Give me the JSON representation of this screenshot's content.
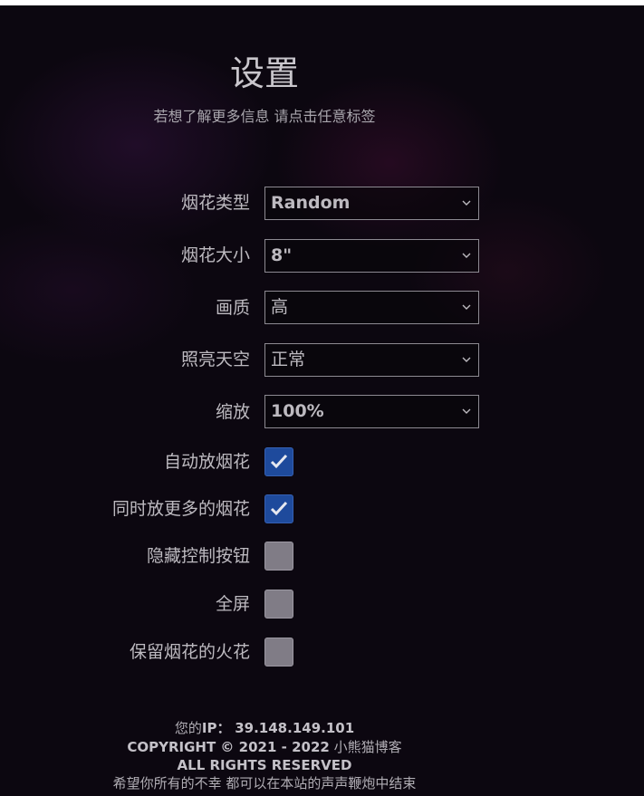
{
  "header": {
    "title": "设置",
    "subtitle": "若想了解更多信息 请点击任意标签"
  },
  "settings": {
    "firework_type": {
      "label": "烟花类型",
      "value": "Random"
    },
    "firework_size": {
      "label": "烟花大小",
      "value": "8\""
    },
    "quality": {
      "label": "画质",
      "value": "高"
    },
    "sky_lighting": {
      "label": "照亮天空",
      "value": "正常"
    },
    "zoom": {
      "label": "缩放",
      "value": "100%"
    },
    "auto_launch": {
      "label": "自动放烟花",
      "checked": true
    },
    "more_fireworks": {
      "label": "同时放更多的烟花",
      "checked": true
    },
    "hide_controls": {
      "label": "隐藏控制按钮",
      "checked": false
    },
    "fullscreen": {
      "label": "全屏",
      "checked": false
    },
    "persist_sparks": {
      "label": "保留烟花的火花",
      "checked": false
    }
  },
  "footer": {
    "ip_label": "您的",
    "ip_key": "IP：",
    "ip_value": "39.148.149.101",
    "copyright": "COPYRIGHT © 2021 - 2022",
    "site_name": "小熊猫博客",
    "rights": "ALL RIGHTS RESERVED",
    "message": "希望你所有的不幸 都可以在本站的声声鞭炮中结束"
  },
  "colors": {
    "checkbox_checked": "#1e4a9c",
    "checkbox_unchecked": "#807c86",
    "text": "#bdbac0",
    "background": "#0c0710"
  },
  "icons": {
    "select_arrow": "chevron-down-icon",
    "check": "checkmark-icon"
  }
}
